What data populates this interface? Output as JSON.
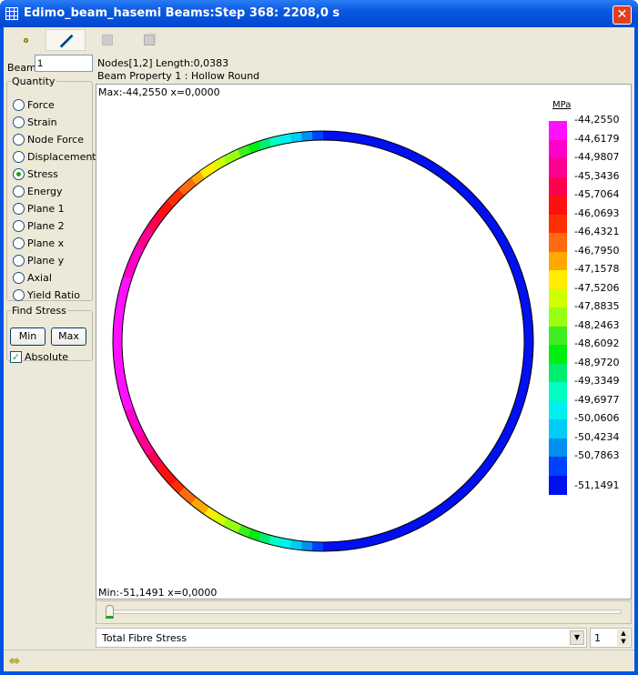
{
  "window": {
    "title": "Edimo_beam_hasemi Beams:Step 368: 2208,0 s",
    "close": "✕"
  },
  "toolbar": {
    "items": [
      "node-tool",
      "beam-tool",
      "shell-tool",
      "solid-tool"
    ],
    "selected": "beam-tool"
  },
  "beam": {
    "label": "Beam",
    "value": "1"
  },
  "info": {
    "nodes": "Nodes[1,2] Length:0,0383",
    "property": "Beam Property 1 : Hollow Round"
  },
  "quantity": {
    "label": "Quantity",
    "options": [
      "Force",
      "Strain",
      "Node Force",
      "Displacement",
      "Stress",
      "Energy",
      "Plane 1",
      "Plane 2",
      "Plane x",
      "Plane y",
      "Axial",
      "Yield Ratio"
    ],
    "selected": "Stress"
  },
  "find": {
    "label": "Find Stress",
    "min": "Min",
    "max": "Max",
    "absolute": "Absolute",
    "absolute_checked": true
  },
  "plot": {
    "max_text": "Max:-44,2550 x=0,0000",
    "min_text": "Min:-51,1491 x=0,0000"
  },
  "legend": {
    "unit": "MPa",
    "labels": [
      "-44,2550",
      "-44,6179",
      "-44,9807",
      "-45,3436",
      "-45,7064",
      "-46,0693",
      "-46,4321",
      "-46,7950",
      "-47,1578",
      "-47,5206",
      "-47,8835",
      "-48,2463",
      "-48,6092",
      "-48,9720",
      "-49,3349",
      "-49,6977",
      "-50,0606",
      "-50,4234",
      "-50,7863",
      "-51,1491"
    ],
    "colors": [
      "#ff10ff",
      "#ff00c8",
      "#ff0090",
      "#ff0050",
      "#ff1010",
      "#ff3000",
      "#ff6a10",
      "#ffa800",
      "#ffee00",
      "#d0ff00",
      "#98ff10",
      "#40ee20",
      "#00ee10",
      "#00ee70",
      "#00ffc0",
      "#00f0f0",
      "#00ccf8",
      "#0090f0",
      "#0040ff",
      "#0010f0"
    ]
  },
  "footer": {
    "mode": "Total Fibre Stress",
    "layer": "1"
  },
  "slider": {
    "position": 0
  }
}
